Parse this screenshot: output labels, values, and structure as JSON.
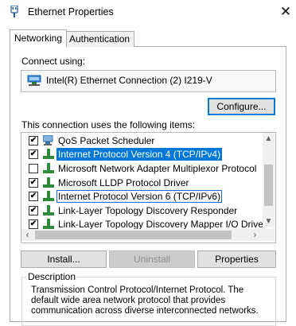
{
  "window": {
    "title": "Ethernet Properties",
    "close_glyph": "✕"
  },
  "tabs": [
    {
      "label": "Networking",
      "active": true
    },
    {
      "label": "Authentication",
      "active": false
    }
  ],
  "connect": {
    "label": "Connect using:",
    "adapter": "Intel(R) Ethernet Connection (2) I219-V",
    "configure_label": "Configure..."
  },
  "items": {
    "label": "This connection uses the following items:",
    "rows": [
      {
        "text": "QoS Packet Scheduler",
        "checked": true,
        "icon": "qos-scheduler-icon"
      },
      {
        "text": "Internet Protocol Version 4 (TCP/IPv4)",
        "checked": true,
        "icon": "protocol-icon",
        "selected": true
      },
      {
        "text": "Microsoft Network Adapter Multiplexor Protocol",
        "checked": false,
        "icon": "protocol-icon"
      },
      {
        "text": "Microsoft LLDP Protocol Driver",
        "checked": true,
        "icon": "protocol-icon"
      },
      {
        "text": "Internet Protocol Version 6 (TCP/IPv6)",
        "checked": true,
        "icon": "protocol-icon",
        "outlined": true
      },
      {
        "text": "Link-Layer Topology Discovery Responder",
        "checked": true,
        "icon": "protocol-icon"
      },
      {
        "text": "Link-Layer Topology Discovery Mapper I/O Driver",
        "checked": true,
        "icon": "protocol-icon"
      }
    ]
  },
  "buttons": {
    "install": "Install...",
    "uninstall": "Uninstall",
    "properties": "Properties"
  },
  "description": {
    "title": "Description",
    "text": "Transmission Control Protocol/Internet Protocol. The default wide area network protocol that provides communication across diverse interconnected networks."
  },
  "colors": {
    "accent": "#0078d7",
    "highlight_outline": "#1a6ad8"
  }
}
